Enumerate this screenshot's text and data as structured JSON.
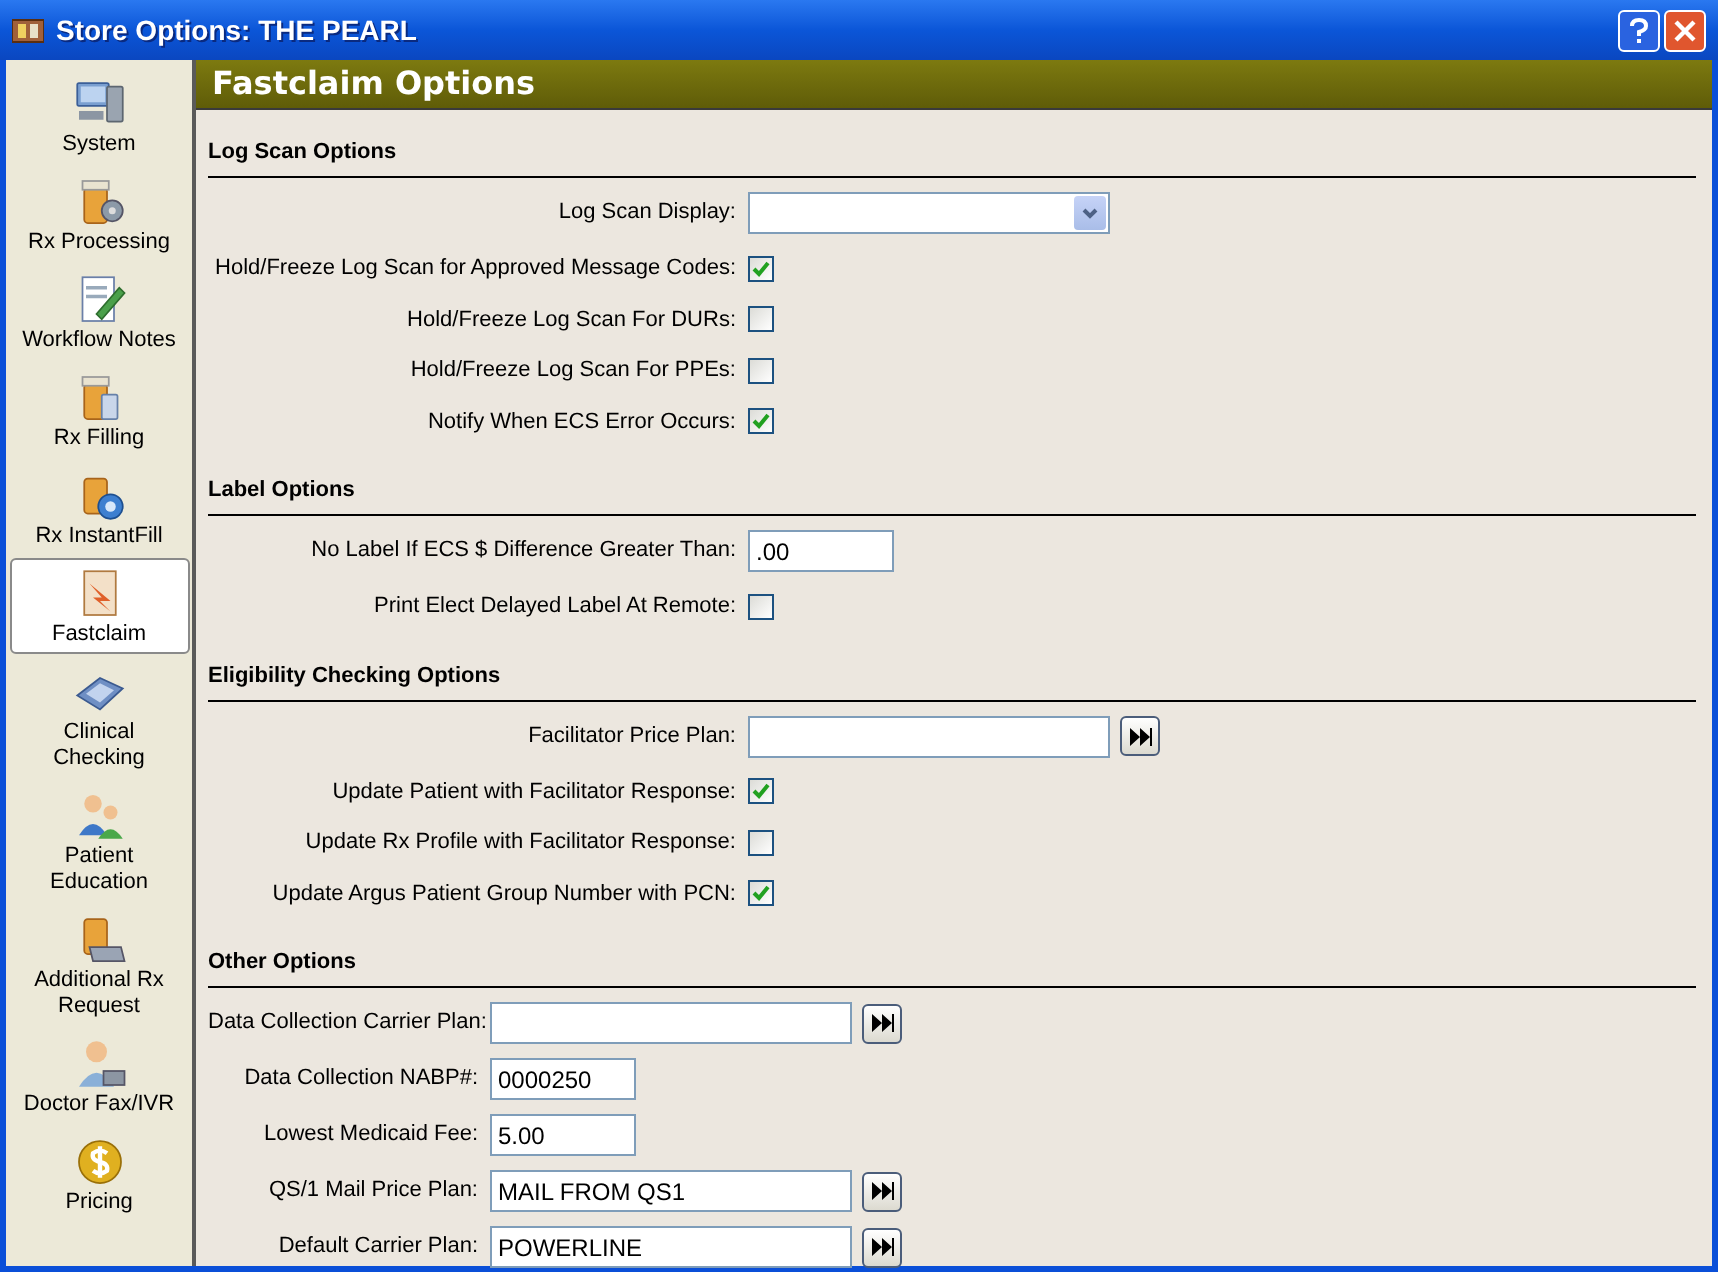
{
  "window": {
    "title": "Store Options: THE PEARL"
  },
  "sidebar": {
    "items": [
      {
        "label": "System",
        "selected": false
      },
      {
        "label": "Rx Processing",
        "selected": false
      },
      {
        "label": "Workflow Notes",
        "selected": false
      },
      {
        "label": "Rx Filling",
        "selected": false
      },
      {
        "label": "Rx InstantFill",
        "selected": false
      },
      {
        "label": "Fastclaim",
        "selected": true
      },
      {
        "label": "Clinical Checking",
        "selected": false
      },
      {
        "label": "Patient Education",
        "selected": false
      },
      {
        "label": "Additional Rx Request",
        "selected": false
      },
      {
        "label": "Doctor Fax/IVR",
        "selected": false
      },
      {
        "label": "Pricing",
        "selected": false
      }
    ]
  },
  "header": "Fastclaim Options",
  "sections": [
    {
      "title": "Log Scan Options",
      "rows": [
        {
          "kind": "dropdown",
          "label": "Log Scan Display:"
        },
        {
          "kind": "checkbox",
          "label": "Hold/Freeze Log Scan for Approved Message Codes:",
          "checked": true
        },
        {
          "kind": "checkbox",
          "label": "Hold/Freeze Log Scan For DURs:",
          "checked": false
        },
        {
          "kind": "checkbox",
          "label": "Hold/Freeze Log Scan For PPEs:",
          "checked": false
        },
        {
          "kind": "checkbox",
          "label": "Notify When ECS Error Occurs:",
          "checked": true
        }
      ]
    },
    {
      "title": "Label Options",
      "rows": [
        {
          "kind": "short",
          "label": "No Label If ECS $ Difference Greater Than:",
          "value": ".00"
        },
        {
          "kind": "checkbox",
          "label": "Print Elect Delayed Label At Remote:",
          "checked": false
        }
      ]
    },
    {
      "title": "Eligibility Checking Options",
      "rows": [
        {
          "kind": "lookup",
          "label": "Facilitator Price Plan:"
        },
        {
          "kind": "checkbox",
          "label": "Update Patient with Facilitator Response:",
          "checked": true
        },
        {
          "kind": "checkbox",
          "label": "Update Rx Profile with Facilitator Response:",
          "checked": false
        },
        {
          "kind": "checkbox",
          "label": "Update Argus Patient Group Number with PCN:",
          "checked": true
        }
      ]
    },
    {
      "title": "Other Options",
      "rows": [
        {
          "kind": "lookup",
          "label": "Data Collection Carrier Plan:"
        },
        {
          "kind": "short",
          "label": "Data Collection NABP#:",
          "value": "0000250"
        },
        {
          "kind": "short",
          "label": "Lowest Medicaid Fee:",
          "value": "5.00"
        },
        {
          "kind": "lookup",
          "label": "QS/1 Mail Price Plan:",
          "value": "MAIL FROM QS1"
        },
        {
          "kind": "lookup",
          "label": "Default Carrier Plan:",
          "value": "POWERLINE"
        }
      ]
    }
  ]
}
